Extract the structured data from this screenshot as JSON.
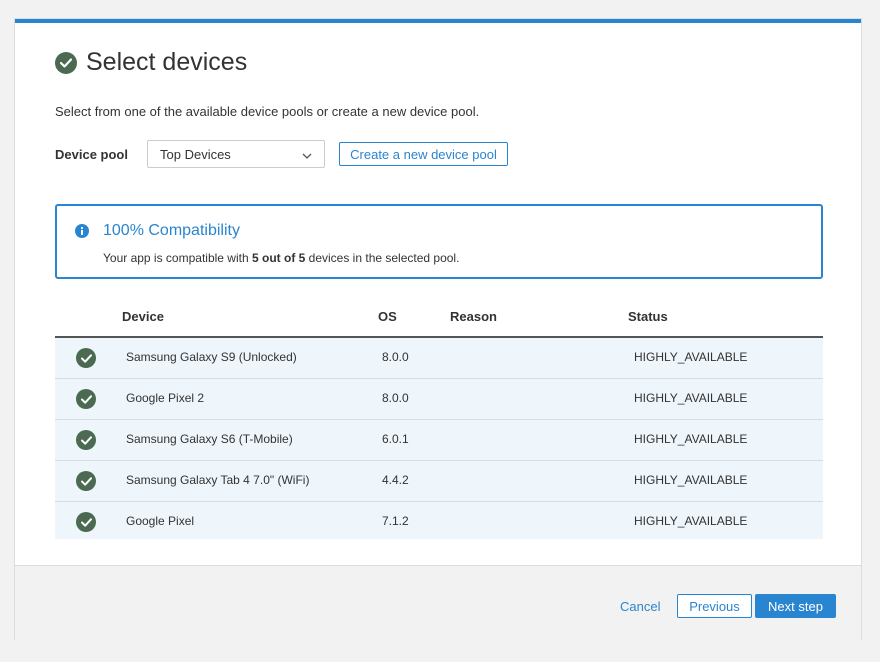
{
  "page": {
    "title": "Select devices",
    "subtitle": "Select from one of the available device pools or create a new device pool."
  },
  "pool": {
    "label": "Device pool",
    "selected": "Top Devices",
    "create_button": "Create a new device pool"
  },
  "compat": {
    "title": "100% Compatibility",
    "text_prefix": "Your app is compatible with ",
    "text_bold": "5 out of 5",
    "text_suffix": " devices in the selected pool."
  },
  "table": {
    "columns": [
      "Device",
      "OS",
      "Reason",
      "Status"
    ],
    "rows": [
      {
        "device": "Samsung Galaxy S9 (Unlocked)",
        "os": "8.0.0",
        "reason": "",
        "status": "HIGHLY_AVAILABLE"
      },
      {
        "device": "Google Pixel 2",
        "os": "8.0.0",
        "reason": "",
        "status": "HIGHLY_AVAILABLE"
      },
      {
        "device": "Samsung Galaxy S6 (T-Mobile)",
        "os": "6.0.1",
        "reason": "",
        "status": "HIGHLY_AVAILABLE"
      },
      {
        "device": "Samsung Galaxy Tab 4 7.0\" (WiFi)",
        "os": "4.4.2",
        "reason": "",
        "status": "HIGHLY_AVAILABLE"
      },
      {
        "device": "Google Pixel",
        "os": "7.1.2",
        "reason": "",
        "status": "HIGHLY_AVAILABLE"
      }
    ]
  },
  "footer": {
    "cancel": "Cancel",
    "previous": "Previous",
    "next": "Next step"
  },
  "icons": {
    "title": "check-circle-icon",
    "info": "info-icon",
    "dropdown": "chevron-down-icon",
    "row": "check-circle-icon"
  },
  "colors": {
    "accent": "#2a85d0",
    "check": "#4b6a51",
    "row_bg": "#eef5fb"
  }
}
